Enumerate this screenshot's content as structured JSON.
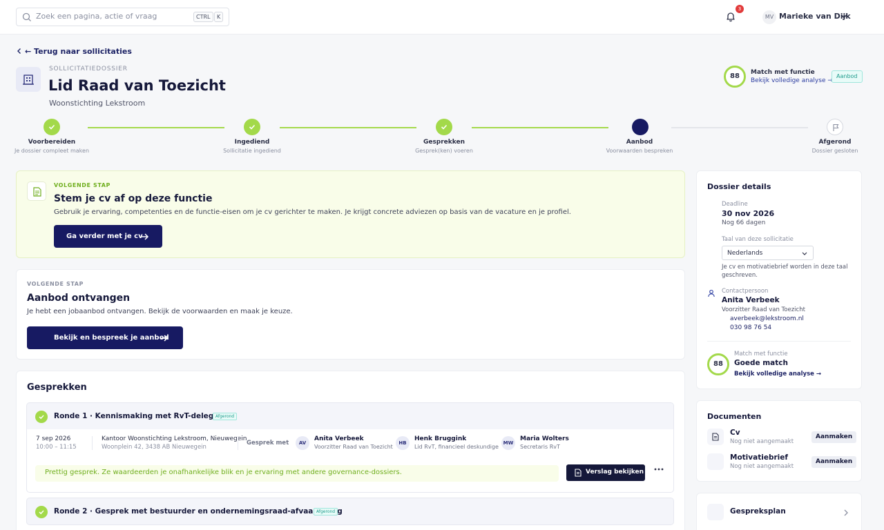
{
  "topbar": {
    "search_placeholder": "Zoek een pagina, actie of vraag",
    "shortcut_ctrl": "CTRL",
    "shortcut_k": "K",
    "notifications": "3",
    "user_initials": "MV",
    "user_name": "Marieke van Dijk"
  },
  "back_label": "← Terug naar sollicitaties",
  "header": {
    "kicker": "SOLLICITATIEDOSSIER",
    "title": "Lid Raad van Toezicht",
    "org": "Woonstichting Lekstroom",
    "match_score": "88",
    "match_title": "Match met functie",
    "match_link": "Bekijk volledige analyse →",
    "status": "Aanbod"
  },
  "steps": [
    {
      "label": "Voorbereiden",
      "sub": "Je dossier compleet maken",
      "state": "done"
    },
    {
      "label": "Ingediend",
      "sub": "Sollicitatie ingediend",
      "state": "done"
    },
    {
      "label": "Gesprekken",
      "sub": "Gesprek(ken) voeren",
      "state": "done"
    },
    {
      "label": "Aanbod",
      "sub": "Voorwaarden bespreken",
      "state": "current"
    },
    {
      "label": "Afgerond",
      "sub": "Dossier gesloten",
      "state": "pending"
    }
  ],
  "next_step_cv": {
    "kicker": "VOLGENDE STAP",
    "title": "Stem je cv af op deze functie",
    "text": "Gebruik je ervaring, competenties en de functie-eisen om je cv gerichter te maken. Je krijgt concrete adviezen op basis van de vacature en je profiel.",
    "button": "Ga verder met je cv"
  },
  "next_step_offer": {
    "kicker": "VOLGENDE STAP",
    "title": "Aanbod ontvangen",
    "text": "Je hebt een jobaanbod ontvangen. Bekijk de voorwaarden en maak je keuze.",
    "button": "Bekijk en bespreek je aanbod"
  },
  "gesprekken": {
    "title": "Gesprekken",
    "rounds": [
      {
        "title": "Ronde 1 · Kennismaking met RvT-delegatie",
        "status": "Afgerond",
        "date": "7 sep 2026",
        "time": "10:00 – 11:15",
        "location": "Kantoor Woonstichting Lekstroom, Nieuwegein",
        "address": "Woonplein 42, 3438 AB Nieuwegein",
        "with_label": "Gesprek met",
        "people": [
          {
            "initials": "AV",
            "name": "Anita Verbeek",
            "role": "Voorzitter Raad van Toezicht"
          },
          {
            "initials": "HB",
            "name": "Henk Bruggink",
            "role": "Lid RvT, financieel deskundige"
          },
          {
            "initials": "MW",
            "name": "Maria Wolters",
            "role": "Secretaris RvT"
          }
        ],
        "note": "Prettig gesprek. Ze waardeerden je onafhankelijke blik en je ervaring met andere governance-dossiers.",
        "report_button": "Verslag bekijken"
      },
      {
        "title": "Ronde 2 · Gesprek met bestuurder en ondernemingsraad-afvaardiging",
        "status": "Afgerond"
      }
    ]
  },
  "dossier": {
    "title": "Dossier details",
    "deadline_label": "Deadline",
    "deadline": "30 nov 2026",
    "deadline_sub": "Nog 66 dagen",
    "lang_label": "Taal van deze sollicitatie",
    "lang_value": "Nederlands",
    "lang_hint": "Je cv en motivatiebrief worden in deze taal geschreven.",
    "contact_label": "Contactpersoon",
    "contact_name": "Anita Verbeek",
    "contact_role": "Voorzitter Raad van Toezicht",
    "contact_email": "averbeek@lekstroom.nl",
    "contact_phone": "030 98 76 54",
    "match_label": "Match met functie",
    "match_value": "Goede match",
    "match_score": "88",
    "match_link": "Bekijk volledige analyse →"
  },
  "documents": {
    "title": "Documenten",
    "items": [
      {
        "name": "Cv",
        "status": "Nog niet aangemaakt",
        "action": "Aanmaken"
      },
      {
        "name": "Motivatiebrief",
        "status": "Nog niet aangemaakt",
        "action": "Aanmaken"
      }
    ]
  },
  "gespreksplan": {
    "title": "Gespreksplan"
  },
  "colors": {
    "accent": "#171a62",
    "success": "#a3d94a",
    "status": "#1c9b8b"
  }
}
